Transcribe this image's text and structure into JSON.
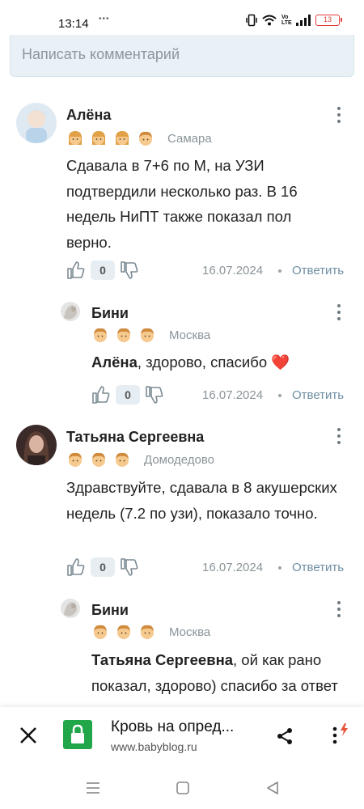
{
  "status_bar": {
    "time": "13:14",
    "dots": "•••",
    "network_label": "Vo LTE",
    "battery": "13",
    "battery_color": "#e03a3a"
  },
  "comment_input": {
    "placeholder": "Написать комментарий"
  },
  "comments": [
    {
      "author": "Алёна",
      "city": "Самара",
      "text": "Сдавала в 7+6 по М, на УЗИ подтвердили несколько раз. В 16 недель НиПТ также показал пол верно.",
      "likes": "0",
      "date": "16.07.2024",
      "reply": "Ответить",
      "badges": [
        "girl-icon",
        "girl-icon",
        "girl-icon",
        "boy-icon"
      ]
    },
    {
      "author": "Бини",
      "mention": "Алёна",
      "text": ", здорово, спасибо ❤️",
      "city": "Москва",
      "likes": "0",
      "date": "16.07.2024",
      "reply": "Ответить",
      "badges": [
        "boy-icon",
        "boy-icon",
        "boy-icon"
      ]
    },
    {
      "author": "Татьяна Сергеевна",
      "city": "Домодедово",
      "text": "Здравствуйте, сдавала в 8 акушерских недель (7.2 по узи), показало точно.",
      "likes": "0",
      "date": "16.07.2024",
      "reply": "Ответить",
      "badges": [
        "boy-icon",
        "boy-icon",
        "boy-icon"
      ]
    },
    {
      "author": "Бини",
      "mention": "Татьяна Сергеевна",
      "text": ", ой как рано показал, здорово) спасибо за ответ",
      "city": "Москва",
      "badges": [
        "boy-icon",
        "boy-icon",
        "boy-icon"
      ]
    }
  ],
  "browser_bar": {
    "title": "Кровь на опред...",
    "url": "www.babyblog.ru",
    "lock_color": "#22a64a"
  },
  "colors": {
    "accent_link": "#6e8ea3",
    "muted": "#8a9499",
    "input_bg": "#e9f1f6"
  }
}
